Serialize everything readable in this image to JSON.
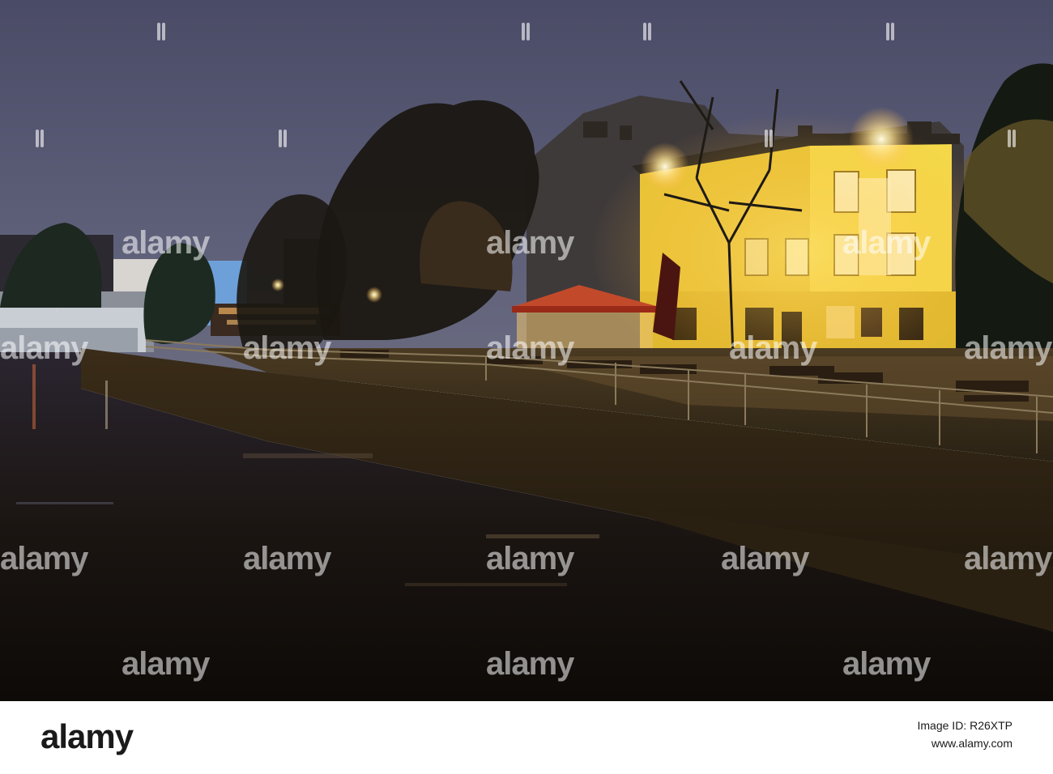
{
  "watermark": {
    "text": "alamy"
  },
  "footer": {
    "logo": "alamy",
    "image_id_line": "Image ID: R26XTP",
    "url": "www.alamy.com"
  },
  "colors": {
    "sky": "#585a74",
    "water": "#1a1410",
    "pub_facade": "#f2d23a",
    "lamp_glow": "#ffe89a"
  }
}
